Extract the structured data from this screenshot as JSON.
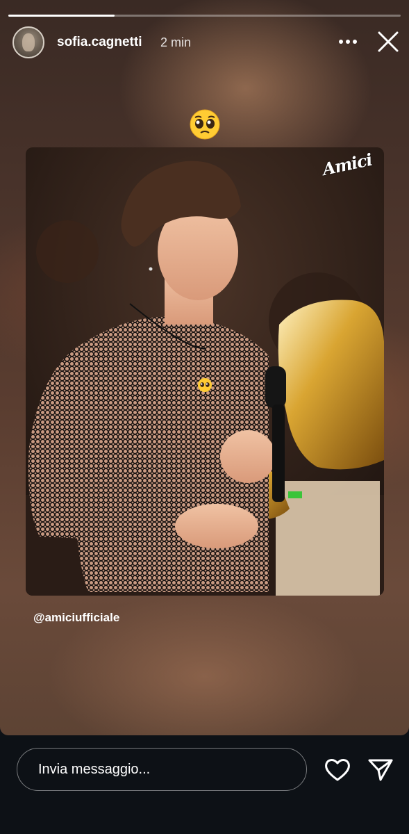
{
  "story": {
    "progress": 0.27,
    "author": {
      "username": "sofia.cagnetti",
      "time_ago": "2 min"
    },
    "sticker_emoji": "pleading-face",
    "photo": {
      "watermark": "Amici",
      "description_emoji": "pleading-face"
    },
    "mention": "@amiciufficiale"
  },
  "footer": {
    "message_placeholder": "Invia messaggio...",
    "heart_icon": "heart-outline-icon",
    "share_icon": "paper-plane-icon"
  },
  "colors": {
    "background": "#0d1116",
    "text": "#ffffff"
  }
}
